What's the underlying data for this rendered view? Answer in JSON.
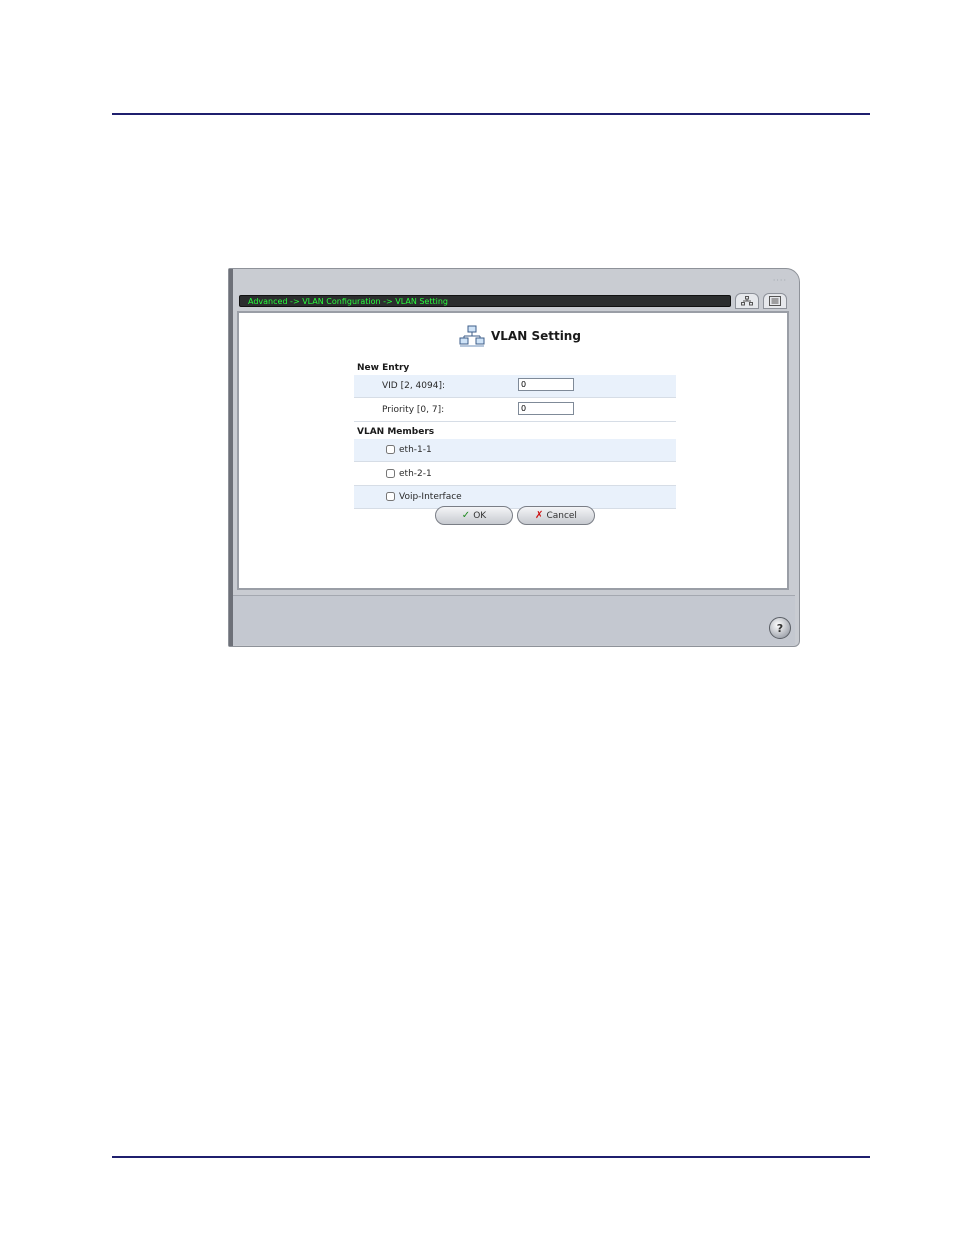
{
  "breadcrumb": "Advanced -> VLAN Configuration -> VLAN Setting",
  "page_title": "VLAN Setting",
  "new_entry": {
    "heading": "New Entry",
    "vid_label": "VID [2, 4094]:",
    "vid_value": "0",
    "priority_label": "Priority [0, 7]:",
    "priority_value": "0"
  },
  "vlan_members": {
    "heading": "VLAN Members",
    "items": [
      {
        "label": "eth-1-1",
        "checked": false
      },
      {
        "label": "eth-2-1",
        "checked": false
      },
      {
        "label": "Voip-Interface",
        "checked": false
      }
    ]
  },
  "buttons": {
    "ok_label": "OK",
    "cancel_label": "Cancel"
  },
  "icons": {
    "title": "network-icon",
    "tab_1": "network-map-icon",
    "tab_2": "list-view-icon",
    "ok": "checkmark-icon",
    "cancel": "x-icon",
    "help": "help-icon"
  },
  "colors": {
    "breadcrumb_text": "#28ff3c",
    "breadcrumb_bg": "#2b2d2e",
    "row_shade": "#e9f1fb",
    "rule": "#1f1f6e"
  }
}
